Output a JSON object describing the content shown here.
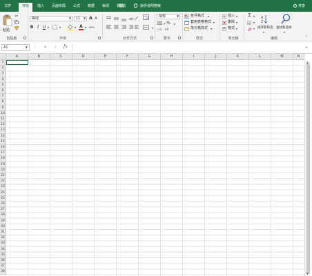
{
  "tabs": [
    "文件",
    "开始",
    "插入",
    "页面布局",
    "公式",
    "数据",
    "审阅",
    "视图",
    "帮助"
  ],
  "tell_me": "操作说明搜索",
  "share": "共享",
  "ribbon": {
    "clipboard": {
      "paste": "粘贴",
      "label": "剪贴板"
    },
    "font": {
      "name": "等线",
      "size": "11",
      "bold": "B",
      "italic": "I",
      "underline": "U",
      "grow": "A",
      "shrink": "A",
      "font_color": "A",
      "wen": "wén",
      "label": "字体"
    },
    "alignment": {
      "label": "对齐方式"
    },
    "number": {
      "format": "常规",
      "percent": "%",
      "comma": ",",
      "label": "数字"
    },
    "styles": {
      "conditional": "条件格式",
      "table": "套用表格格式",
      "cell": "单元格样式",
      "label": "样式"
    },
    "cells": {
      "insert": "插入",
      "delete": "删除",
      "format": "格式",
      "label": "单元格"
    },
    "editing": {
      "sum": "Σ",
      "sort_filter": "排序和筛选",
      "find_select": "查找和选择",
      "label": "编辑"
    }
  },
  "formula_bar": {
    "name_box": "A1",
    "fx": "fx",
    "cancel": "✕",
    "enter": "✓",
    "value": ""
  },
  "grid": {
    "columns": [
      "A",
      "B",
      "C",
      "D",
      "E",
      "F",
      "G",
      "H",
      "I",
      "J",
      "K",
      "L",
      "M",
      "N"
    ],
    "rows": [
      "1",
      "2",
      "3",
      "4",
      "5",
      "6",
      "7",
      "8",
      "9",
      "10",
      "11",
      "12",
      "13",
      "14",
      "15",
      "16",
      "17",
      "18",
      "19",
      "20",
      "21",
      "22",
      "23",
      "24",
      "25",
      "26",
      "27",
      "28",
      "29",
      "30",
      "31",
      "32",
      "33",
      "34",
      "35",
      "36",
      "37",
      "38"
    ]
  },
  "colors": {
    "accent": "#217346",
    "ribbon_bg": "#f3f3f3",
    "header_bg": "#e6e6e6"
  }
}
